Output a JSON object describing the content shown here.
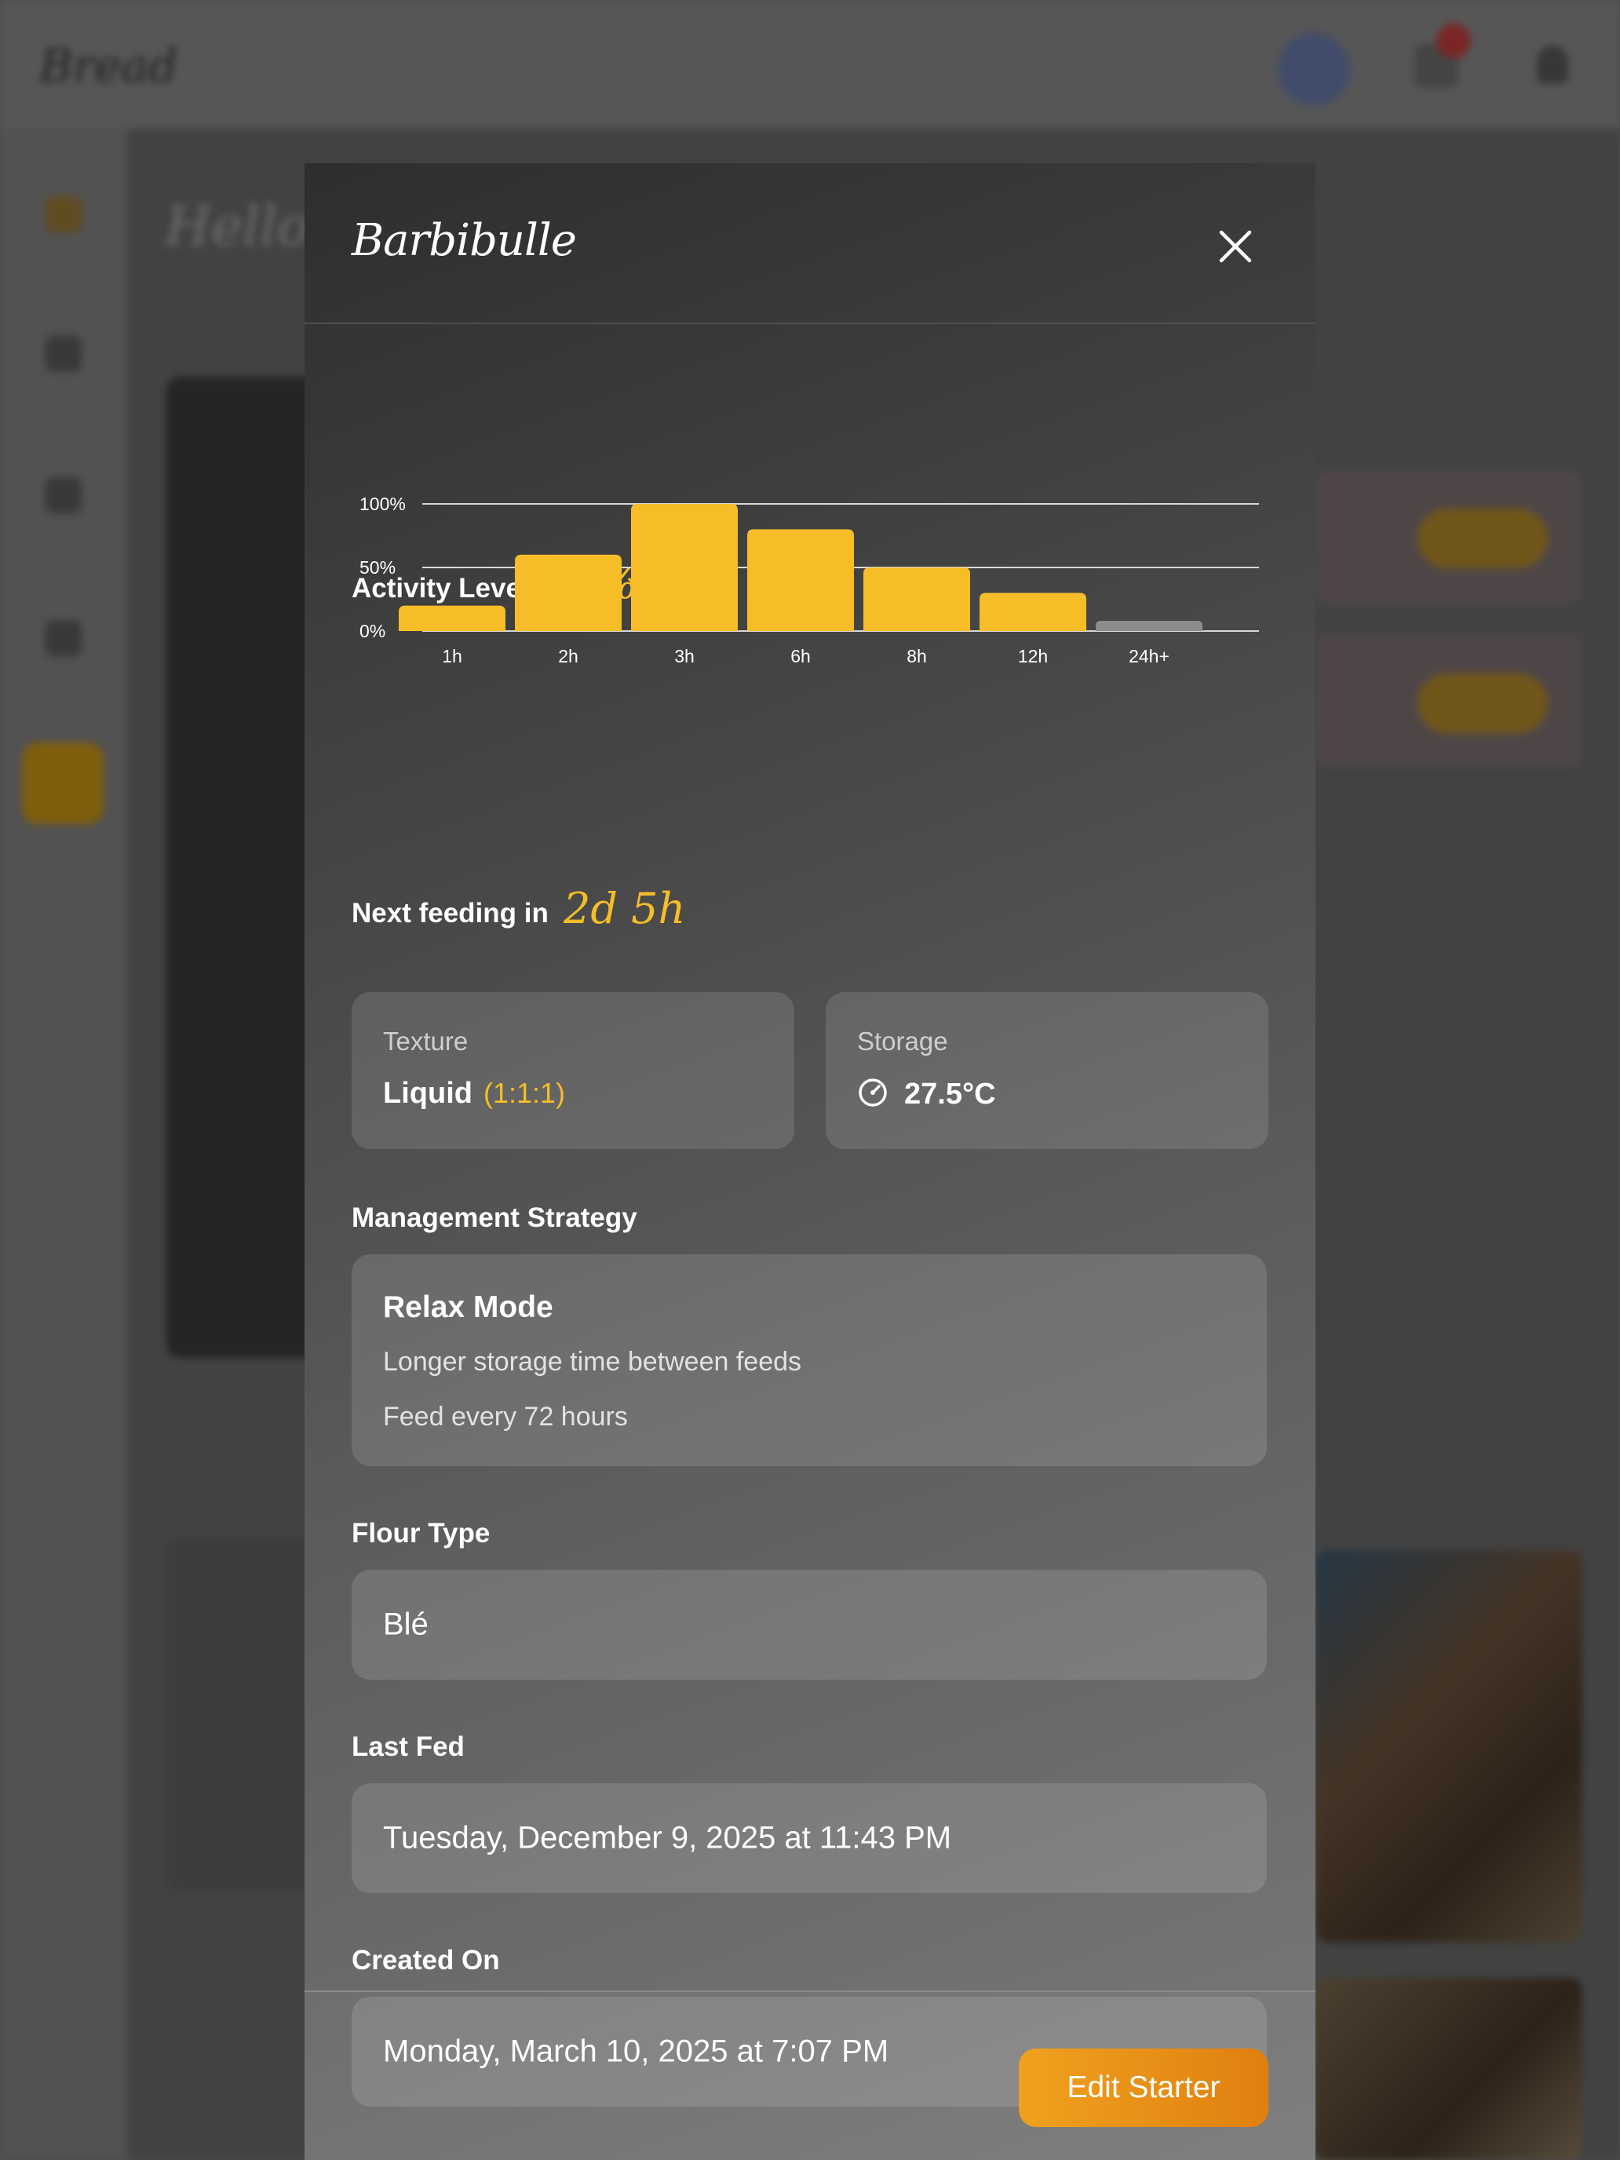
{
  "background_app": {
    "logo": "Bread"
  },
  "modal": {
    "title": "Barbibulle",
    "close_icon": "close-icon",
    "activity": {
      "label": "Activity Level",
      "value": "17%",
      "trend_icon": "trend-down-icon"
    },
    "next_feeding": {
      "label": "Next feeding in",
      "value": "2d 5h"
    },
    "texture": {
      "label": "Texture",
      "value": "Liquid",
      "ratio": "(1:1:1)"
    },
    "storage": {
      "label": "Storage",
      "icon": "gauge-icon",
      "value": "27.5°C"
    },
    "management": {
      "label": "Management Strategy",
      "mode": "Relax Mode",
      "description": "Longer storage time between feeds",
      "schedule": "Feed every 72 hours"
    },
    "flour": {
      "label": "Flour Type",
      "value": "Blé"
    },
    "last_fed": {
      "label": "Last Fed",
      "value": "Tuesday, December 9, 2025 at 11:43 PM"
    },
    "created_on": {
      "label": "Created On",
      "value": "Monday, March 10, 2025 at 7:07 PM"
    },
    "edit_button": "Edit Starter"
  },
  "chart_data": {
    "type": "bar",
    "categories": [
      "1h",
      "2h",
      "3h",
      "6h",
      "8h",
      "12h",
      "24h+"
    ],
    "values": [
      20,
      60,
      100,
      80,
      50,
      30,
      8
    ],
    "highlight_color": "#f6bd28",
    "muted_color": "#8c8c8c",
    "muted_categories": [
      "24h+"
    ],
    "y_ticks": [
      "0%",
      "50%",
      "100%"
    ],
    "ylim": [
      0,
      100
    ],
    "grid": true
  },
  "colors": {
    "accent": "#f6bd28",
    "button": "#e8901a"
  }
}
